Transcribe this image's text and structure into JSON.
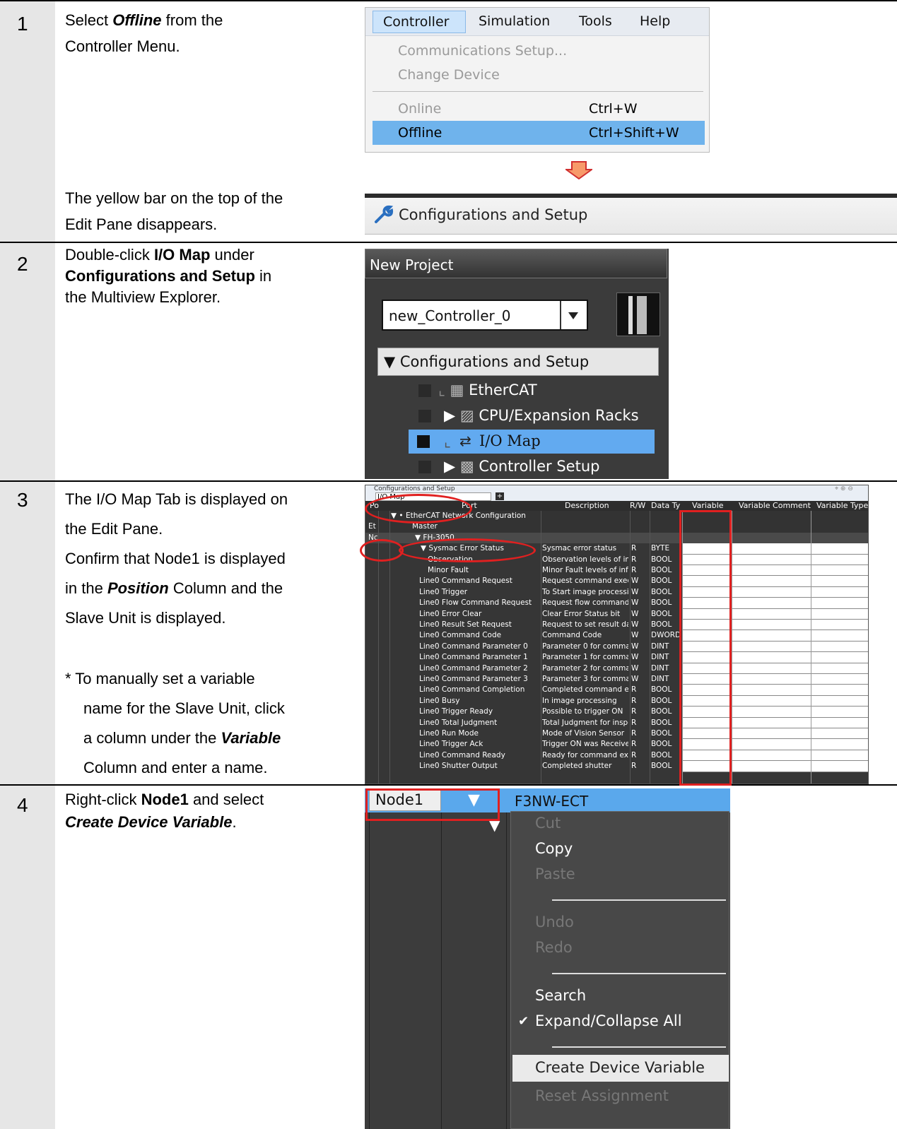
{
  "steps": [
    {
      "number": "1",
      "text_a": "Select ",
      "text_b": "Offline",
      "text_c": " from the",
      "text_d": "Controller Menu.",
      "text_e": "The yellow bar on the top of the",
      "text_f": "Edit Pane disappears."
    },
    {
      "number": "2",
      "l1a": "Double-click ",
      "l1b": "I/O Map",
      "l1c": " under",
      "l2a": "Configurations and Setup",
      "l2b": " in",
      "l3": "the Multiview Explorer."
    },
    {
      "number": "3",
      "l1": "The I/O Map Tab is displayed on",
      "l2": "the Edit Pane.",
      "l3": "Confirm that Node1 is displayed",
      "l4a": "in the ",
      "l4b": "Position",
      "l4c": " Column and the",
      "l5": "Slave Unit is displayed.",
      "n1": "* To manually set a variable",
      "n2": "name for the Slave Unit, click",
      "n3a": "a column under the ",
      "n3b": "Variable",
      "n4": "Column and enter a name."
    },
    {
      "number": "4",
      "l1a": "Right-click ",
      "l1b": "Node1",
      "l1c": " and select",
      "l2a": "Create Device Variable",
      "l2b": "."
    }
  ],
  "menu": {
    "bar": [
      "Controller",
      "Simulation",
      "Tools",
      "Help"
    ],
    "items": [
      {
        "label": "Communications Setup...",
        "shortcut": ""
      },
      {
        "label": "Change Device",
        "shortcut": ""
      },
      {
        "label": "Online",
        "shortcut": "Ctrl+W"
      },
      {
        "label": "Offline",
        "shortcut": "Ctrl+Shift+W"
      }
    ]
  },
  "cfg_bar_title": "Configurations and Setup",
  "explorer": {
    "title": "New Project",
    "controller": "new_Controller_0",
    "section": "Configurations and Setup",
    "items": [
      "EtherCAT",
      "CPU/Expansion Racks",
      "I/O Map",
      "Controller Setup"
    ]
  },
  "iomap": {
    "window_title": "Configurations and Setup",
    "tab": "I/O Map",
    "headers": [
      "Po",
      "Port",
      "Description",
      "R/W",
      "Data Ty",
      "Variable",
      "Variable Comment",
      "Variable Type"
    ],
    "rows": [
      {
        "pos": "",
        "port": "EtherCAT Network Configuration",
        "desc": "",
        "rw": "",
        "dt": ""
      },
      {
        "pos": "Et",
        "port": "Master",
        "desc": "",
        "rw": "",
        "dt": ""
      },
      {
        "pos": "No",
        "port": "FH-3050",
        "desc": "",
        "rw": "",
        "dt": ""
      },
      {
        "pos": "",
        "port": "Sysmac Error Status",
        "desc": "Sysmac error status",
        "rw": "R",
        "dt": "BYTE"
      },
      {
        "pos": "",
        "port": "Observation",
        "desc": "Observation levels of inf",
        "rw": "R",
        "dt": "BOOL"
      },
      {
        "pos": "",
        "port": "Minor Fault",
        "desc": "Minor Fault levels of info",
        "rw": "R",
        "dt": "BOOL"
      },
      {
        "pos": "",
        "port": "Line0 Command Request",
        "desc": "Request command execu",
        "rw": "W",
        "dt": "BOOL"
      },
      {
        "pos": "",
        "port": "Line0 Trigger",
        "desc": "To Start image processin",
        "rw": "W",
        "dt": "BOOL"
      },
      {
        "pos": "",
        "port": "Line0 Flow Command Request",
        "desc": "Request flow command",
        "rw": "W",
        "dt": "BOOL"
      },
      {
        "pos": "",
        "port": "Line0 Error Clear",
        "desc": "Clear Error Status bit",
        "rw": "W",
        "dt": "BOOL"
      },
      {
        "pos": "",
        "port": "Line0 Result Set Request",
        "desc": "Request to set result dat",
        "rw": "W",
        "dt": "BOOL"
      },
      {
        "pos": "",
        "port": "Line0 Command Code",
        "desc": "Command Code",
        "rw": "W",
        "dt": "DWORD"
      },
      {
        "pos": "",
        "port": "Line0 Command Parameter 0",
        "desc": "Parameter 0 for commar",
        "rw": "W",
        "dt": "DINT"
      },
      {
        "pos": "",
        "port": "Line0 Command Parameter 1",
        "desc": "Parameter 1 for commar",
        "rw": "W",
        "dt": "DINT"
      },
      {
        "pos": "",
        "port": "Line0 Command Parameter 2",
        "desc": "Parameter 2 for commar",
        "rw": "W",
        "dt": "DINT"
      },
      {
        "pos": "",
        "port": "Line0 Command Parameter 3",
        "desc": "Parameter 3 for commar",
        "rw": "W",
        "dt": "DINT"
      },
      {
        "pos": "",
        "port": "Line0 Command Completion",
        "desc": "Completed command ex",
        "rw": "R",
        "dt": "BOOL"
      },
      {
        "pos": "",
        "port": "Line0 Busy",
        "desc": "In image processing",
        "rw": "R",
        "dt": "BOOL"
      },
      {
        "pos": "",
        "port": "Line0 Trigger Ready",
        "desc": "Possible to trigger ON",
        "rw": "R",
        "dt": "BOOL"
      },
      {
        "pos": "",
        "port": "Line0 Total Judgment",
        "desc": "Total Judgment for inspe",
        "rw": "R",
        "dt": "BOOL"
      },
      {
        "pos": "",
        "port": "Line0 Run Mode",
        "desc": "Mode of Vision Sensor",
        "rw": "R",
        "dt": "BOOL"
      },
      {
        "pos": "",
        "port": "Line0 Trigger Ack",
        "desc": "Trigger ON was Receivec",
        "rw": "R",
        "dt": "BOOL"
      },
      {
        "pos": "",
        "port": "Line0 Command Ready",
        "desc": "Ready for command exe",
        "rw": "R",
        "dt": "BOOL"
      },
      {
        "pos": "",
        "port": "Line0 Shutter Output",
        "desc": "Completed shutter",
        "rw": "R",
        "dt": "BOOL"
      }
    ]
  },
  "context": {
    "node": "Node1",
    "device": "F3NW-ECT",
    "items": [
      "Cut",
      "Copy",
      "Paste",
      "Undo",
      "Redo",
      "Search",
      "Expand/Collapse All",
      "Create Device Variable",
      "Reset Assignment"
    ]
  }
}
